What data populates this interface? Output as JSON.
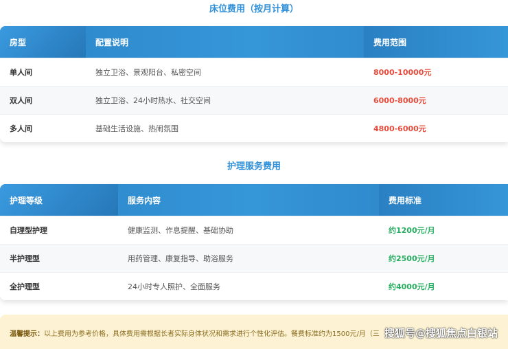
{
  "bed": {
    "title": "床位费用（按月计算）",
    "headers": [
      "房型",
      "配置说明",
      "费用范围"
    ],
    "rows": [
      [
        "单人间",
        "独立卫浴、景观阳台、私密空间",
        "8000-10000元"
      ],
      [
        "双人间",
        "独立卫浴、24小时热水、社交空间",
        "6000-8000元"
      ],
      [
        "多人间",
        "基础生活设施、热闹氛围",
        "4800-6000元"
      ]
    ]
  },
  "care": {
    "title": "护理服务费用",
    "headers": [
      "护理等级",
      "服务内容",
      "费用标准"
    ],
    "rows": [
      [
        "自理型护理",
        "健康监测、作息提醒、基础协助",
        "约1200元/月"
      ],
      [
        "半护理型",
        "用药管理、康复指导、助浴服务",
        "约2500元/月"
      ],
      [
        "全护理型",
        "24小时专人照护、全面服务",
        "约4000元/月"
      ]
    ]
  },
  "notice": {
    "label": "温馨提示：",
    "text": "以上费用为参考价格，具体费用需根据长者实际身体状况和需求进行个性化评估。餐费标准约为1500元/月（三"
  },
  "watermark": "搜狐号@搜狐焦点白银站",
  "colors": {
    "accent": "#2f8fd8",
    "price_red": "#e74c3c",
    "price_green": "#27ae60"
  }
}
